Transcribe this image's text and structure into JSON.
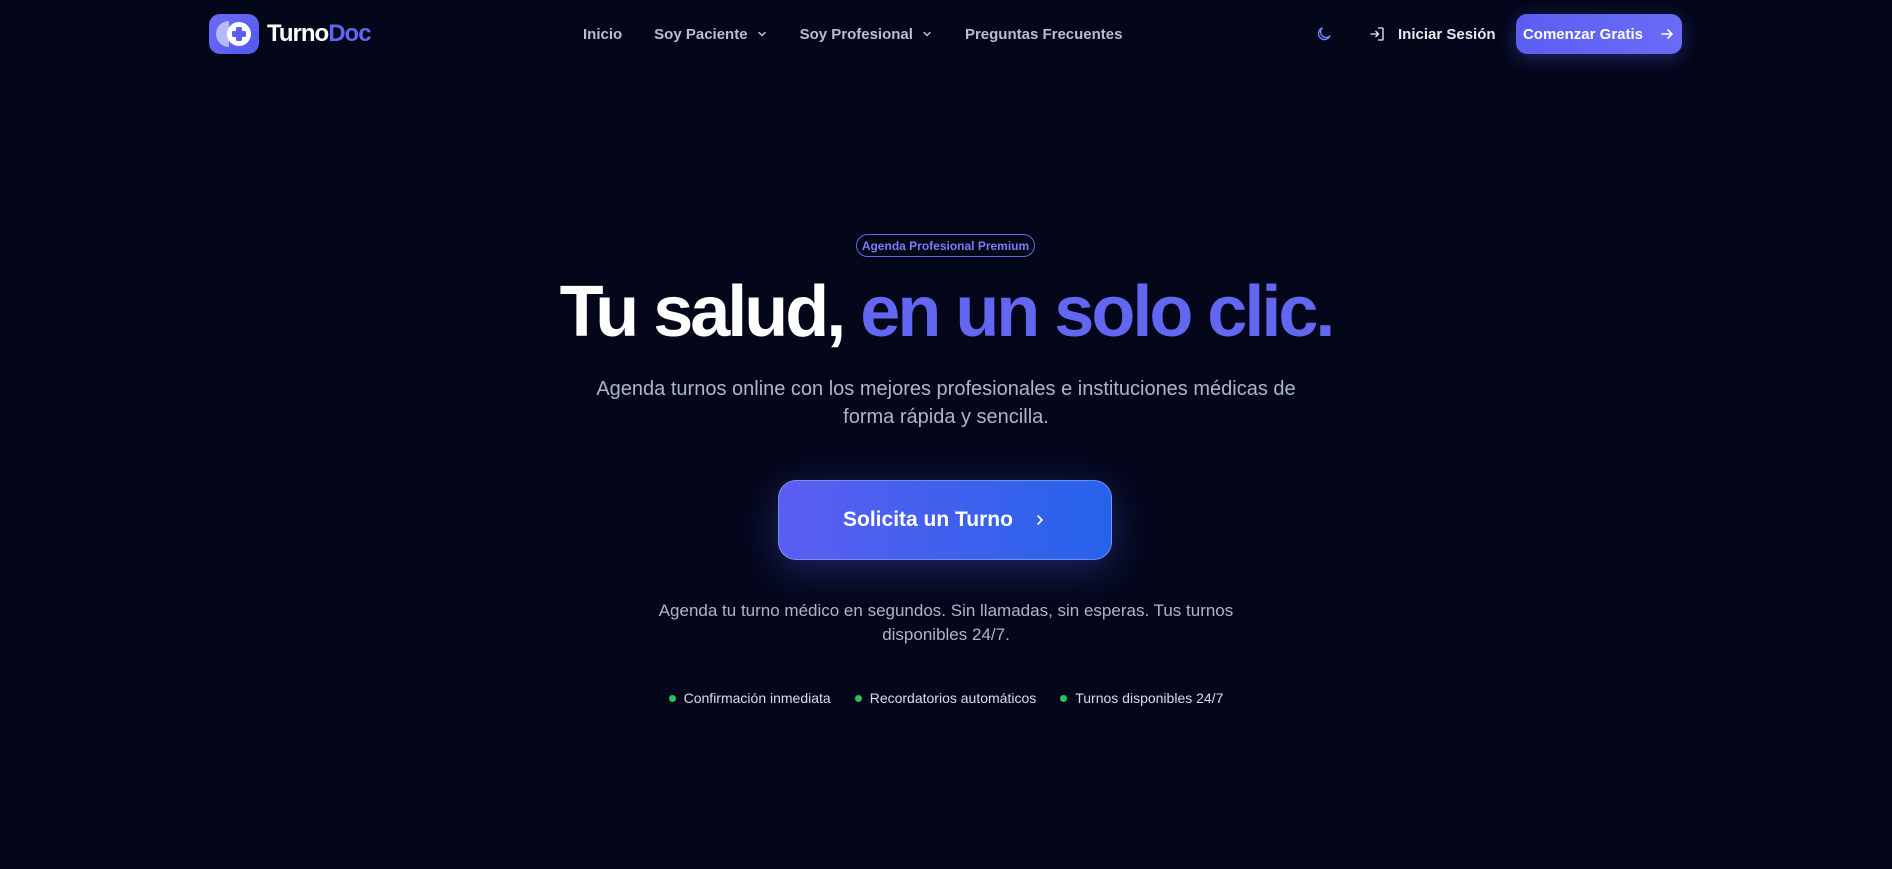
{
  "brand": {
    "name_part1": "Turno",
    "name_part2": "Doc",
    "logo_icon": "medical-cross-icon"
  },
  "nav": {
    "items": [
      {
        "label": "Inicio",
        "dropdown": false
      },
      {
        "label": "Soy Paciente",
        "dropdown": true
      },
      {
        "label": "Soy Profesional",
        "dropdown": true
      },
      {
        "label": "Preguntas Frecuentes",
        "dropdown": false
      }
    ]
  },
  "header_actions": {
    "theme_icon": "moon-icon",
    "login_label": "Iniciar Sesión",
    "login_icon": "login-icon",
    "cta_label": "Comenzar Gratis",
    "cta_icon": "arrow-right-icon"
  },
  "hero": {
    "badge": "Agenda Profesional Premium",
    "headline_part1": "Tu salud,",
    "headline_part2": "en un solo clic.",
    "subheadline": "Agenda turnos online con los mejores profesionales e instituciones médicas de forma rápida y sencilla.",
    "cta_label": "Solicita un Turno",
    "cta_icon": "chevron-right-icon",
    "note": "Agenda tu turno médico en segundos. Sin llamadas, sin esperas. Tus turnos disponibles 24/7."
  },
  "features": [
    "Confirmación inmediata",
    "Recordatorios automáticos",
    "Turnos disponibles 24/7"
  ],
  "colors": {
    "background": "#04071a",
    "accent": "#6366f1",
    "accent_blue": "#2563eb",
    "muted_text": "#aeb5c8",
    "status_green": "#22c55e"
  }
}
